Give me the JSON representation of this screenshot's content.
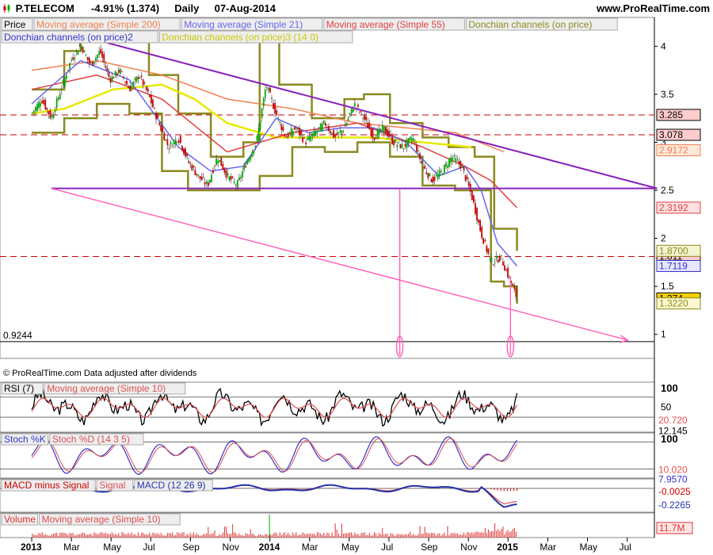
{
  "header": {
    "symbol": "P.TELECOM",
    "change": "-4.91% (1.374)",
    "period": "Daily",
    "date": "07-Aug-2014",
    "site": "www.ProRealTime.com"
  },
  "copyright": "© ProRealTime.com Data adjusted after dividends",
  "colors": {
    "price_up": "#00aa00",
    "price_down": "#cc0000",
    "ma200": "#f08050",
    "ma21": "#6666ee",
    "ma55": "#e04040",
    "donchian1": "#8a8a20",
    "donchian2": "#3333cc",
    "donchian3": "#e8e800",
    "trendline": "#8822bb",
    "fan": "#ff66bb",
    "rsi": "#000000",
    "rsi_ma": "#e05050",
    "stoch_k": "#3333cc",
    "stoch_d": "#e05050",
    "macd_hist": "#cc0000",
    "macd": "#2233aa",
    "volume": "#e03030"
  },
  "chart_data": [
    {
      "type": "candlestick",
      "panel": "price",
      "legend": [
        {
          "label": "Price",
          "color": "#000000"
        },
        {
          "label": "Moving average (Simple 200)",
          "color": "#f08050"
        },
        {
          "label": "Moving average (Simple 21)",
          "color": "#6666ee"
        },
        {
          "label": "Moving average (Simple 55)",
          "color": "#e04040"
        },
        {
          "label": "Donchian channels (on price)",
          "color": "#8a8a20"
        },
        {
          "label": "Donchian channels (on price)2",
          "color": "#3333cc"
        },
        {
          "label": "Donchian channels (on price)3 (14 0)",
          "color": "#c8c800"
        }
      ],
      "x_ticks": [
        "2013",
        "Mar",
        "May",
        "Jul",
        "Sep",
        "Nov",
        "2014",
        "Mar",
        "May",
        "Jul",
        "Sep",
        "Nov",
        "2015",
        "Mar",
        "May",
        "Jul"
      ],
      "y_ticks": [
        1,
        1.5,
        2,
        2.5,
        3,
        3.5,
        4
      ],
      "y_tick_labels": [
        "1",
        "1.5",
        "2",
        "2.5",
        "3",
        "3.5",
        "4"
      ],
      "ylim": [
        0.75,
        4.3
      ],
      "x_range_months": [
        0,
        19.5
      ],
      "close": [
        [
          0.0,
          3.3
        ],
        [
          0.3,
          3.45
        ],
        [
          0.6,
          3.25
        ],
        [
          0.9,
          3.55
        ],
        [
          1.2,
          3.85
        ],
        [
          1.5,
          4.02
        ],
        [
          1.8,
          3.8
        ],
        [
          2.1,
          3.95
        ],
        [
          2.4,
          3.65
        ],
        [
          2.7,
          3.75
        ],
        [
          3.0,
          3.55
        ],
        [
          3.3,
          3.7
        ],
        [
          3.6,
          3.48
        ],
        [
          3.9,
          3.2
        ],
        [
          4.2,
          2.95
        ],
        [
          4.5,
          3.05
        ],
        [
          4.8,
          2.8
        ],
        [
          5.1,
          2.65
        ],
        [
          5.4,
          2.55
        ],
        [
          5.7,
          2.85
        ],
        [
          6.0,
          2.65
        ],
        [
          6.3,
          2.55
        ],
        [
          6.6,
          2.8
        ],
        [
          6.9,
          3.0
        ],
        [
          7.2,
          3.6
        ],
        [
          7.5,
          3.3
        ],
        [
          7.8,
          3.05
        ],
        [
          8.1,
          3.15
        ],
        [
          8.4,
          3.0
        ],
        [
          8.7,
          3.1
        ],
        [
          9.0,
          3.2
        ],
        [
          9.3,
          3.05
        ],
        [
          9.6,
          3.15
        ],
        [
          9.9,
          3.4
        ],
        [
          10.2,
          3.25
        ],
        [
          10.5,
          3.05
        ],
        [
          10.8,
          3.15
        ],
        [
          11.1,
          3.0
        ],
        [
          11.4,
          2.95
        ],
        [
          11.7,
          3.05
        ],
        [
          12.0,
          2.75
        ],
        [
          12.3,
          2.6
        ],
        [
          12.6,
          2.7
        ],
        [
          12.9,
          2.85
        ],
        [
          13.2,
          2.75
        ],
        [
          13.5,
          2.45
        ],
        [
          13.8,
          2.05
        ],
        [
          14.1,
          1.75
        ],
        [
          14.4,
          1.8
        ],
        [
          14.7,
          1.55
        ],
        [
          14.9,
          1.374
        ]
      ],
      "ma200": [
        [
          0.0,
          3.75
        ],
        [
          2.0,
          3.85
        ],
        [
          4.0,
          3.7
        ],
        [
          6.0,
          3.45
        ],
        [
          8.0,
          3.35
        ],
        [
          10.0,
          3.2
        ],
        [
          11.5,
          3.15
        ],
        [
          13.0,
          3.1
        ],
        [
          14.5,
          2.9
        ]
      ],
      "ma55": [
        [
          0.0,
          3.55
        ],
        [
          2.0,
          3.7
        ],
        [
          4.0,
          3.45
        ],
        [
          6.0,
          2.9
        ],
        [
          8.0,
          3.1
        ],
        [
          10.0,
          3.2
        ],
        [
          12.0,
          2.95
        ],
        [
          13.3,
          2.75
        ],
        [
          14.1,
          2.6
        ],
        [
          14.9,
          2.319
        ]
      ],
      "ma21": [
        [
          0.0,
          3.4
        ],
        [
          1.5,
          3.85
        ],
        [
          3.0,
          3.65
        ],
        [
          4.5,
          2.95
        ],
        [
          5.5,
          2.7
        ],
        [
          6.5,
          2.75
        ],
        [
          7.5,
          3.25
        ],
        [
          8.5,
          3.1
        ],
        [
          9.5,
          3.15
        ],
        [
          10.5,
          3.15
        ],
        [
          11.5,
          3.0
        ],
        [
          12.5,
          2.65
        ],
        [
          13.3,
          2.75
        ],
        [
          13.8,
          2.5
        ],
        [
          14.3,
          1.95
        ],
        [
          14.9,
          1.712
        ]
      ],
      "ma_yellow": [
        [
          0.0,
          3.3
        ],
        [
          1.0,
          3.35
        ],
        [
          2.5,
          3.55
        ],
        [
          4.0,
          3.6
        ],
        [
          5.0,
          3.45
        ],
        [
          6.0,
          3.2
        ],
        [
          7.5,
          3.05
        ],
        [
          9.0,
          3.05
        ],
        [
          10.5,
          3.05
        ],
        [
          12.0,
          3.0
        ],
        [
          13.5,
          2.95
        ]
      ],
      "donchian_upper": [
        [
          0.0,
          3.55
        ],
        [
          1.0,
          3.95
        ],
        [
          1.5,
          4.1
        ],
        [
          3.0,
          4.05
        ],
        [
          3.6,
          3.7
        ],
        [
          4.5,
          3.3
        ],
        [
          5.5,
          2.85
        ],
        [
          6.5,
          3.0
        ],
        [
          7.0,
          4.2
        ],
        [
          7.6,
          3.6
        ],
        [
          8.6,
          3.25
        ],
        [
          9.6,
          3.45
        ],
        [
          10.2,
          3.5
        ],
        [
          11.0,
          3.2
        ],
        [
          12.0,
          3.05
        ],
        [
          12.8,
          2.95
        ],
        [
          13.6,
          2.85
        ],
        [
          14.2,
          2.1
        ],
        [
          14.9,
          1.87
        ]
      ],
      "donchian_lower": [
        [
          0.0,
          3.1
        ],
        [
          1.0,
          3.25
        ],
        [
          2.0,
          3.4
        ],
        [
          3.0,
          3.3
        ],
        [
          4.0,
          2.7
        ],
        [
          4.8,
          2.5
        ],
        [
          6.0,
          2.5
        ],
        [
          7.0,
          2.65
        ],
        [
          8.0,
          2.95
        ],
        [
          9.0,
          2.9
        ],
        [
          10.0,
          3.0
        ],
        [
          11.0,
          2.85
        ],
        [
          12.0,
          2.55
        ],
        [
          13.0,
          2.5
        ],
        [
          13.8,
          2.5
        ],
        [
          14.1,
          1.55
        ],
        [
          14.5,
          1.5
        ],
        [
          14.9,
          1.32
        ]
      ],
      "trendlines": [
        {
          "color": "#8822bb",
          "points": [
            [
              1.6,
              4.1
            ],
            [
              19.2,
              2.52
            ]
          ]
        },
        {
          "color": "#8822bb",
          "points": [
            [
              0.6,
              2.52
            ],
            [
              19.2,
              2.52
            ]
          ]
        },
        {
          "color": "#ff66bb",
          "points": [
            [
              0.6,
              2.52
            ],
            [
              18.3,
              0.94
            ]
          ]
        }
      ],
      "vertical_markers": [
        {
          "x": 11.3,
          "from": 2.52,
          "to": 0.78,
          "color": "#ff66bb"
        },
        {
          "x": 14.7,
          "from": 1.6,
          "to": 0.78,
          "color": "#ff66bb"
        }
      ],
      "horizontal_lines": [
        {
          "value": 3.285,
          "label": "3.285",
          "style": "dashed",
          "color": "#cc0000",
          "fill": "#ffcccc"
        },
        {
          "value": 3.078,
          "label": "3.078",
          "style": "dashed",
          "color": "#cc0000",
          "fill": "#ffcccc"
        },
        {
          "value": 1.811,
          "label": "1.811",
          "style": "dashed",
          "color": "#cc0000",
          "fill": "#ffcccc"
        },
        {
          "value": 0.9244,
          "label": "0.9244",
          "style": "solid",
          "color": "#000000",
          "fill": "#ffffff"
        }
      ],
      "value_tags": [
        {
          "value": 2.9172,
          "label": "2.9172",
          "color": "#f08050",
          "fill": "#ffe8d8"
        },
        {
          "value": 2.3192,
          "label": "2.3192",
          "color": "#e04040",
          "fill": "#ffe0e0"
        },
        {
          "value": 1.87,
          "label": "1.8700",
          "color": "#8a8a20",
          "fill": "#f4f4d0"
        },
        {
          "value": 1.7119,
          "label": "1.7119",
          "color": "#3333cc",
          "fill": "#e6e6ff"
        },
        {
          "value": 1.374,
          "label": "1.374",
          "color": "#000000",
          "fill": "#f5d000"
        },
        {
          "value": 1.322,
          "label": "1.3220",
          "color": "#8a8a20",
          "fill": "#fff8d0"
        }
      ]
    },
    {
      "type": "line",
      "panel": "rsi",
      "legend": [
        {
          "label": "RSI (7)",
          "color": "#000000"
        },
        {
          "label": "Moving average (Simple 10)",
          "color": "#e05050"
        }
      ],
      "y_tick_labels": [
        "100",
        "50"
      ],
      "ylim": [
        0,
        100
      ],
      "levels": [
        70,
        30
      ],
      "value_tags": [
        {
          "value": 20.72,
          "label": "20.720",
          "color": "#e05050"
        },
        {
          "value": 12.145,
          "label": "12.145",
          "color": "#000000"
        }
      ]
    },
    {
      "type": "line",
      "panel": "stochastic",
      "legend": [
        {
          "label": "Stoch %K",
          "color": "#3333cc"
        },
        {
          "label": "Stoch %D (14 3 5)",
          "color": "#e05050"
        }
      ],
      "y_tick_labels": [
        "100"
      ],
      "ylim": [
        0,
        100
      ],
      "levels": [
        80,
        20
      ],
      "value_tags": [
        {
          "value": 10.02,
          "label": "10.020",
          "color": "#e05050"
        },
        {
          "value": 7.957,
          "label": "7.9570",
          "color": "#3333cc"
        }
      ]
    },
    {
      "type": "line",
      "panel": "macd",
      "legend": [
        {
          "label": "MACD minus Signal",
          "color": "#cc0000"
        },
        {
          "label": "Signal",
          "color": "#e05050"
        },
        {
          "label": "MACD (12 26 9)",
          "color": "#2233aa"
        }
      ],
      "ylim": [
        -0.3,
        0.12
      ],
      "value_tags": [
        {
          "value": -0.0025,
          "label": "-0.0025",
          "color": "#cc0000"
        },
        {
          "value": -0.2265,
          "label": "-0.2265",
          "color": "#2233aa"
        }
      ]
    },
    {
      "type": "bar",
      "panel": "volume",
      "legend": [
        {
          "label": "Volume",
          "color": "#e03030"
        },
        {
          "label": "Moving average (Simple 10)",
          "color": "#e05050"
        }
      ],
      "value_tags": [
        {
          "value": 11.7,
          "label": "11.7M",
          "color": "#e03030"
        }
      ]
    }
  ]
}
